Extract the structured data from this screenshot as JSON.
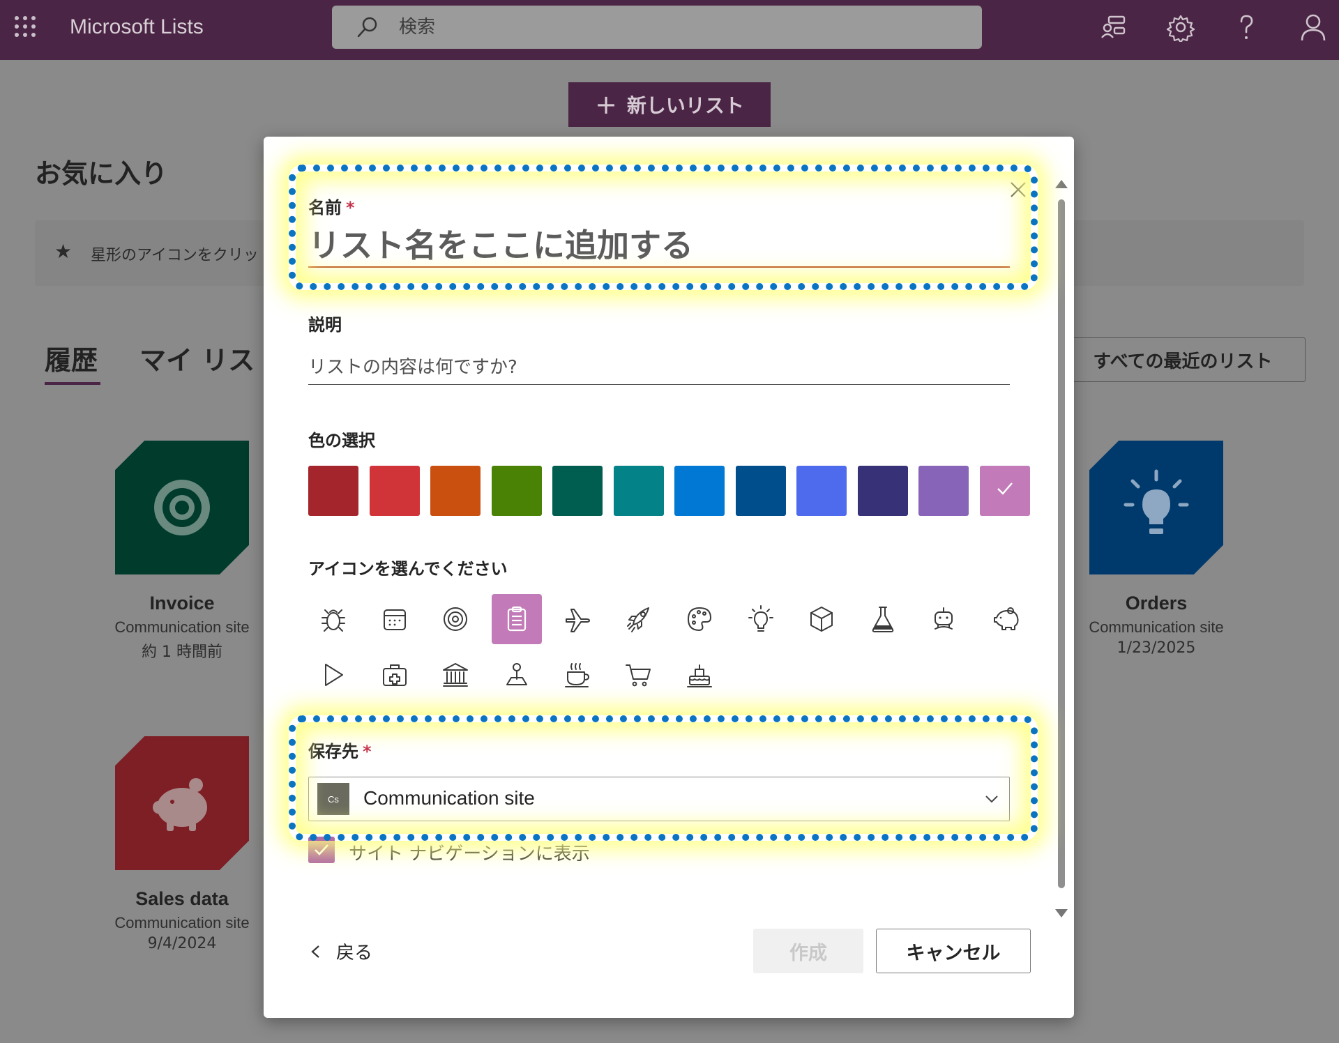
{
  "header": {
    "app_title": "Microsoft Lists",
    "search_placeholder": "検索",
    "icons": [
      "app-launcher-icon",
      "search-icon",
      "lists-feed-icon",
      "gear-icon",
      "help-icon",
      "person-icon"
    ]
  },
  "page": {
    "new_list_label": "新しいリスト",
    "favorites_heading": "お気に入り",
    "favorites_hint": "星形のアイコンをクリッ",
    "tabs": [
      {
        "label": "履歴",
        "selected": true
      },
      {
        "label": "マイ リス",
        "selected": false
      }
    ],
    "recent_lists_label": "すべての最近のリスト",
    "cards": [
      {
        "name": "Invoice",
        "site": "Communication site",
        "date": "約 1 時間前",
        "color": "#003b2c",
        "icon": "target-icon"
      },
      {
        "name": "Sales data",
        "site": "Communication site",
        "date": "9/4/2024",
        "color": "#a4262c",
        "icon": "piggy-bank-icon"
      },
      {
        "name": "Orders",
        "site": "Communication site",
        "date": "1/23/2025",
        "color": "#003a6c",
        "icon": "lightbulb-icon"
      }
    ]
  },
  "dialog": {
    "name_label": "名前",
    "name_required": "*",
    "name_placeholder": "リスト名をここに追加する",
    "description_label": "説明",
    "description_placeholder": "リストの内容は何ですか?",
    "color_label": "色の選択",
    "colors": [
      "#a4262c",
      "#d13438",
      "#ca5010",
      "#498205",
      "#005e50",
      "#038387",
      "#0078d4",
      "#004e8c",
      "#4f6bed",
      "#373277",
      "#8764b8",
      "#c27bb8"
    ],
    "selected_color": "#c27bb8",
    "icon_label": "アイコンを選んでください",
    "icons": [
      "bug-icon",
      "calendar-icon",
      "target-icon",
      "clipboard-icon",
      "airplane-icon",
      "rocket-icon",
      "palette-icon",
      "lightbulb-icon",
      "cube-icon",
      "beaker-icon",
      "robot-icon",
      "piggy-bank-icon",
      "play-icon",
      "first-aid-kit-icon",
      "bank-icon",
      "map-pin-icon",
      "coffee-icon",
      "cart-icon",
      "cake-icon"
    ],
    "selected_icon": "clipboard-icon",
    "location_label": "保存先",
    "location_required": "*",
    "location_badge": "Cs",
    "location_value": "Communication site",
    "show_in_nav_label": "サイト ナビゲーションに表示",
    "show_in_nav_checked": true,
    "back_label": "戻る",
    "create_label": "作成",
    "cancel_label": "キャンセル"
  }
}
